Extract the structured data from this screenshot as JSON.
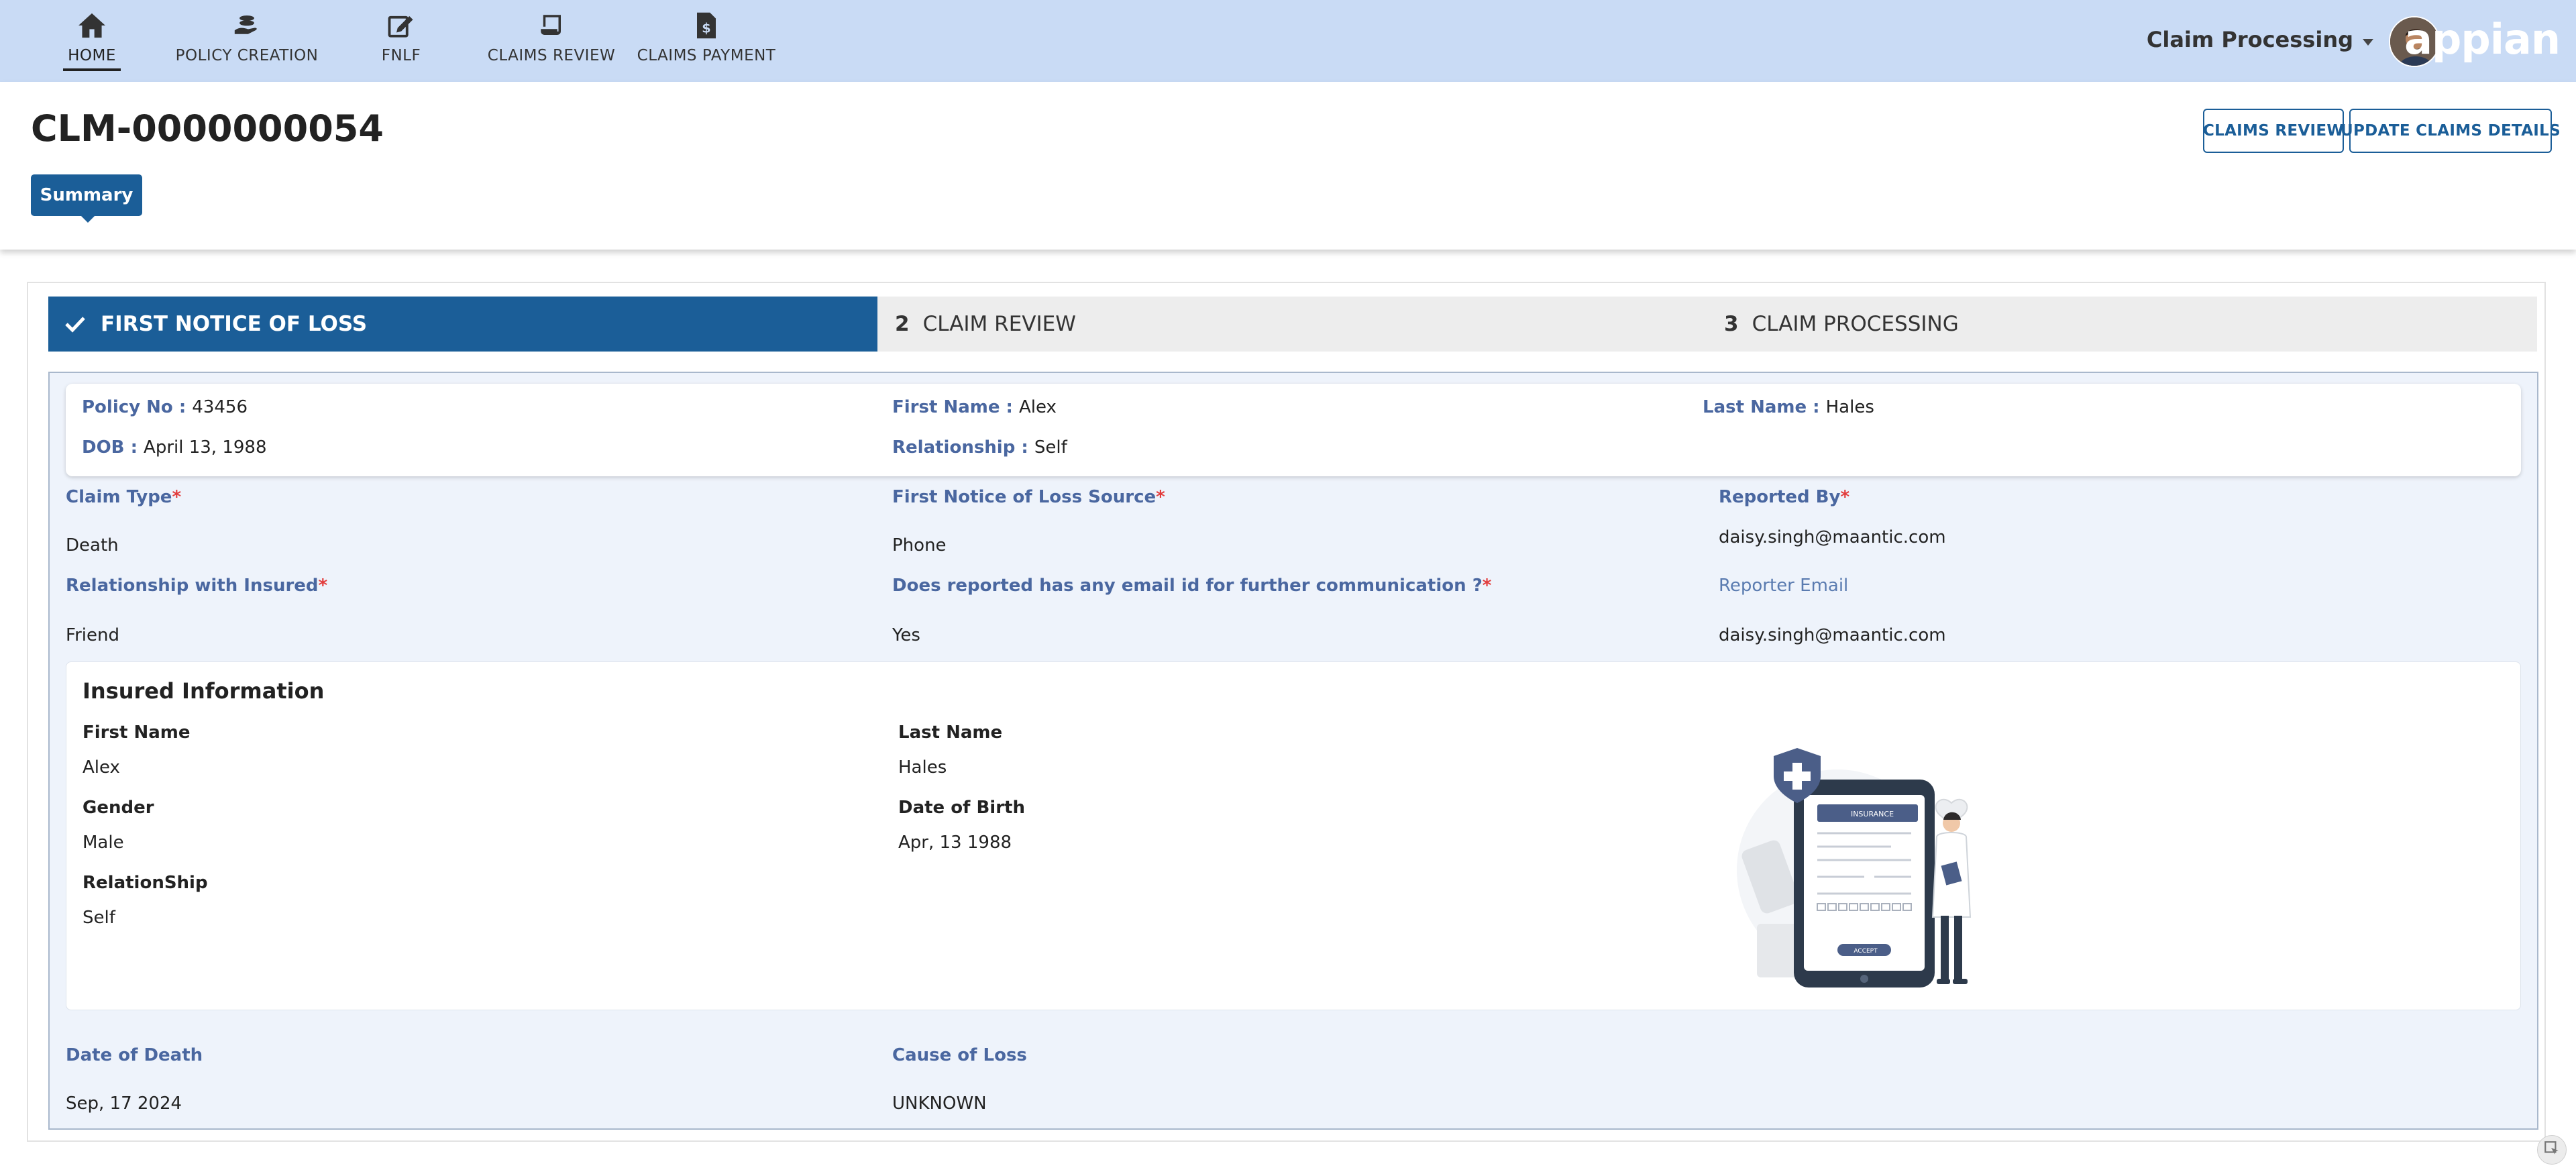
{
  "nav": {
    "items": [
      {
        "label": "HOME",
        "icon": "home-icon",
        "active": true
      },
      {
        "label": "POLICY CREATION",
        "icon": "hand-coins-icon",
        "active": false
      },
      {
        "label": "FNLF",
        "icon": "edit-icon",
        "active": false
      },
      {
        "label": "CLAIMS REVIEW",
        "icon": "scroll-icon",
        "active": false
      },
      {
        "label": "CLAIMS PAYMENT",
        "icon": "dollar-document-icon",
        "active": false
      }
    ],
    "app_name": "Claim Processing",
    "logo": "appian"
  },
  "header": {
    "title": "CLM-0000000054",
    "summary_button": "Summary",
    "claims_review_button": "CLAIMS REVIEW",
    "update_button": "UPDATE CLAIMS DETAILS"
  },
  "stepper": {
    "steps": [
      {
        "number": "",
        "label": "FIRST NOTICE OF LOSS",
        "state": "completed"
      },
      {
        "number": "2",
        "label": "CLAIM REVIEW",
        "state": "pending"
      },
      {
        "number": "3",
        "label": "CLAIM PROCESSING",
        "state": "pending"
      }
    ]
  },
  "policy": {
    "policy_no_label": "Policy No",
    "policy_no": "43456",
    "first_name_label": "First Name",
    "first_name": "Alex",
    "last_name_label": "Last Name",
    "last_name": "Hales",
    "dob_label": "DOB",
    "dob": "April 13, 1988",
    "relationship_label": "Relationship",
    "relationship": "Self"
  },
  "claim": {
    "claim_type_label": "Claim Type",
    "claim_type": "Death",
    "fnol_source_label": "First Notice of Loss Source",
    "fnol_source": "Phone",
    "reported_by_label": "Reported By",
    "reported_by": "daisy.singh@maantic.com",
    "relationship_insured_label": "Relationship with Insured",
    "relationship_insured": "Friend",
    "has_email_label": "Does reported has any email id for further communication ?",
    "has_email": "Yes",
    "reporter_email_label": "Reporter Email",
    "reporter_email": "daisy.singh@maantic.com",
    "date_of_death_label": "Date of Death",
    "date_of_death": "Sep, 17 2024",
    "cause_label": "Cause of Loss",
    "cause": "UNKNOWN"
  },
  "insured": {
    "title": "Insured Information",
    "first_name_label": "First Name",
    "first_name": "Alex",
    "last_name_label": "Last Name",
    "last_name": "Hales",
    "gender_label": "Gender",
    "gender": "Male",
    "dob_label": "Date of Birth",
    "dob": "Apr, 13 1988",
    "relationship_label": "RelationShip",
    "relationship": "Self",
    "illustration_text": {
      "insurance": "INSURANCE",
      "accept": "ACCEPT"
    }
  },
  "colors": {
    "nav_bg": "#c9dbf5",
    "primary": "#1b5e98",
    "label": "#4a67a0",
    "required": "#e23b3b",
    "form_bg": "#eef3fb"
  }
}
